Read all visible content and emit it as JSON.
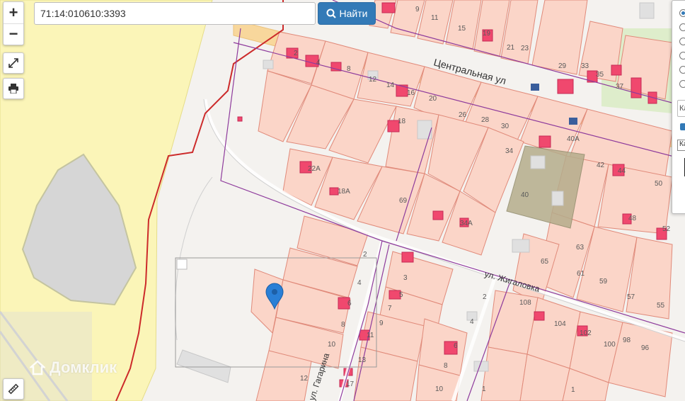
{
  "search": {
    "value": "71:14:010610:3393",
    "button_label": "Найти"
  },
  "zoom": {
    "in_label": "+",
    "out_label": "−"
  },
  "streets": {
    "central": "Центральная ул",
    "zhigalovka": "ул. Жигаловка",
    "gagarina": "ул. Гагарина"
  },
  "house_numbers": {
    "n9": "9",
    "n11": "11",
    "n15": "15",
    "n19": "19",
    "n21": "21",
    "n23": "23",
    "n29": "29",
    "n33": "33",
    "n35": "35",
    "n37": "37",
    "n2": "2",
    "n4": "4",
    "n8": "8",
    "n12": "12",
    "n14": "14",
    "n16": "16",
    "n20": "20",
    "n26": "26",
    "n28": "28",
    "n30": "30",
    "n34": "34",
    "n40a": "40А",
    "n18": "18",
    "n22a": "22А",
    "n18a": "18А",
    "n69": "69",
    "n34a": "34А",
    "n40": "40",
    "n42": "42",
    "n44": "44",
    "n50": "50",
    "n48": "48",
    "n52": "52",
    "n63": "63",
    "n65": "65",
    "n61": "61",
    "n59": "59",
    "n57": "57",
    "n55": "55",
    "s2": "2",
    "s4": "4",
    "s3": "3",
    "s5": "5",
    "s7": "7",
    "s9": "9",
    "s6": "6",
    "s8": "8",
    "s10": "10",
    "s11": "11",
    "s13": "13",
    "s12": "12",
    "s17": "17",
    "z2": "2",
    "z4": "4",
    "z6": "6",
    "z8": "8",
    "z10": "10",
    "z1": "1",
    "n108": "108",
    "n104": "104",
    "n102": "102",
    "n100": "100",
    "n98": "98",
    "n96": "96",
    "e1": "1"
  },
  "panel": {
    "field1": "Ка",
    "field2": "Ка"
  },
  "watermark": "Домклик",
  "colors": {
    "parcel_fill": "#fbd5c8",
    "parcel_stroke": "#e08a7a",
    "building": "#f0486e",
    "boundary": "#cc2a2a",
    "district": "#8e3b9c",
    "road": "#f8d79c",
    "industrial": "#b5ad8c",
    "zone": "#fbf5b8",
    "accent": "#337ab7"
  },
  "icons": {
    "search": "search-icon",
    "fullscreen": "fullscreen-icon",
    "print": "print-icon",
    "ruler": "ruler-icon",
    "pin": "map-pin-icon"
  }
}
